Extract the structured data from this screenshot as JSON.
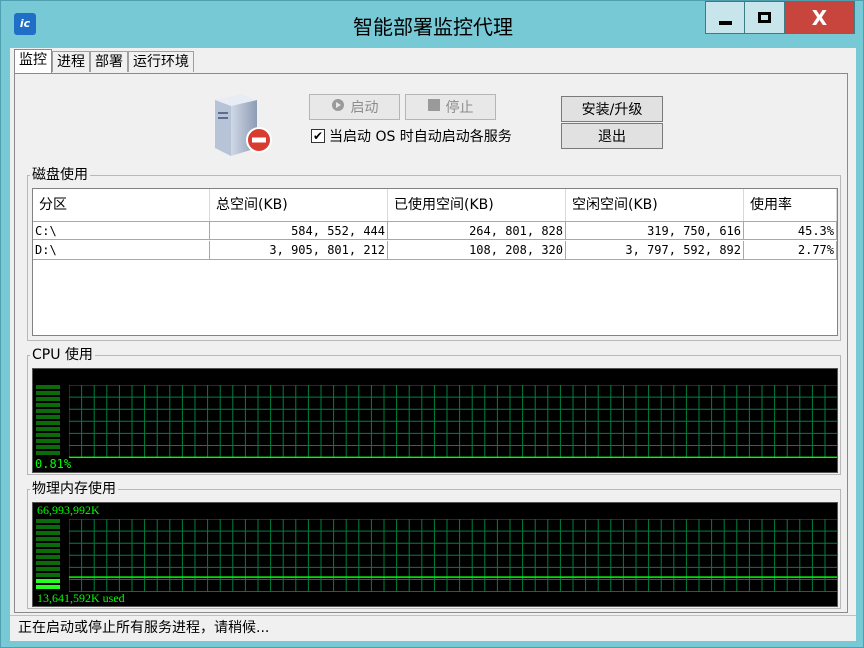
{
  "window": {
    "title": "智能部署监控代理",
    "app_icon_text": "ic",
    "close_glyph": "X"
  },
  "tabs": [
    {
      "label": "监控",
      "active": true
    },
    {
      "label": "进程",
      "active": false
    },
    {
      "label": "部署",
      "active": false
    },
    {
      "label": "运行环境",
      "active": false
    }
  ],
  "controls": {
    "start_label": "启动",
    "stop_label": "停止",
    "install_label": "安装/升级",
    "exit_label": "退出",
    "autostart_label": "当启动 OS 时自动启动各服务",
    "autostart_checked": true
  },
  "disk": {
    "group_label": "磁盘使用",
    "columns": [
      "分区",
      "总空间(KB)",
      "已使用空间(KB)",
      "空闲空间(KB)",
      "使用率"
    ],
    "rows": [
      {
        "partition": "C:\\",
        "total": "584, 552, 444",
        "used": "264, 801, 828",
        "free": "319, 750, 616",
        "rate": "45.3%"
      },
      {
        "partition": "D:\\",
        "total": "3, 905, 801, 212",
        "used": "108, 208, 320",
        "free": "3, 797, 592, 892",
        "rate": "2.77%"
      }
    ]
  },
  "cpu": {
    "group_label": "CPU 使用",
    "percent_text": "0.81%",
    "percent": 0.81
  },
  "memory": {
    "group_label": "物理内存使用",
    "total_text": "66,993,992K",
    "used_text": "13,641,592K used",
    "used_fraction": 0.2036
  },
  "status": {
    "text": "正在启动或停止所有服务进程，请稍候..."
  },
  "colors": {
    "titlebar_bg": "#77c9d6",
    "close_bg": "#c8453e",
    "graph_grid": "#00803e",
    "graph_line": "#00ff00",
    "meter_dim": "#0b6b0b",
    "meter_bright": "#22ff22"
  }
}
